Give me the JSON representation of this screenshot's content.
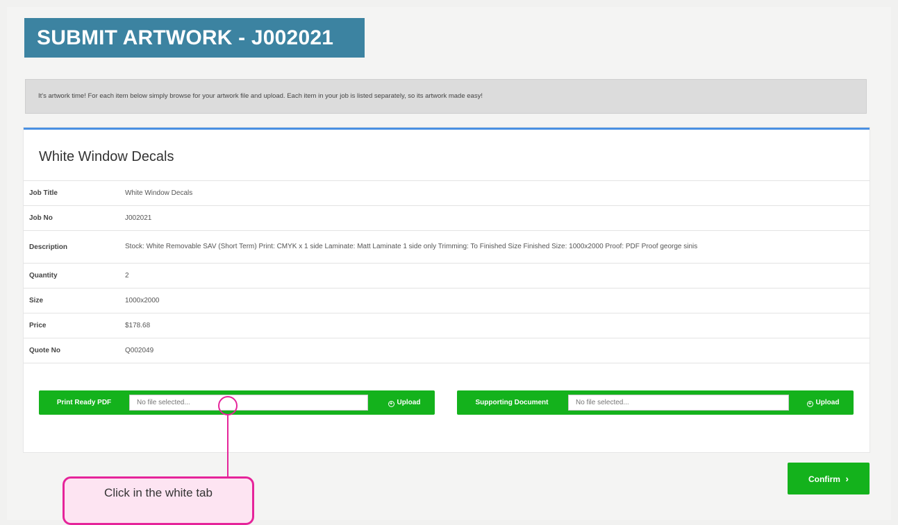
{
  "header": {
    "title": "SUBMIT ARTWORK - J002021"
  },
  "info": {
    "text": "It's artwork time! For each item below simply browse for your artwork file and upload. Each item in your job is listed separately, so its artwork made easy!"
  },
  "item": {
    "title": "White Window Decals",
    "rows": [
      {
        "label": "Job Title",
        "value": "White Window Decals"
      },
      {
        "label": "Job No",
        "value": "J002021"
      },
      {
        "label": "Description",
        "value": "Stock: White Removable SAV (Short Term) Print: CMYK x 1 side Laminate: Matt Laminate 1 side only Trimming: To Finished Size Finished Size: 1000x2000 Proof: PDF Proof george sinis"
      },
      {
        "label": "Quantity",
        "value": "2"
      },
      {
        "label": "Size",
        "value": "1000x2000"
      },
      {
        "label": "Price",
        "value": "$178.68"
      },
      {
        "label": "Quote No",
        "value": "Q002049"
      }
    ],
    "uploads": [
      {
        "label": "Print Ready PDF",
        "placeholder": "No file selected...",
        "button": "Upload",
        "icon": "plus-circle-icon"
      },
      {
        "label": "Supporting Document",
        "placeholder": "No file selected...",
        "button": "Upload",
        "icon": "plus-circle-icon"
      }
    ]
  },
  "actions": {
    "confirm": "Confirm",
    "confirm_icon": "chevron-right-icon",
    "confirm_glyph": "›"
  },
  "callout": {
    "text": "Click in the white tab"
  },
  "colors": {
    "banner": "#3c83a1",
    "accent_green": "#14b21c",
    "panel_border": "#4a90e2",
    "callout": "#e5249a"
  }
}
